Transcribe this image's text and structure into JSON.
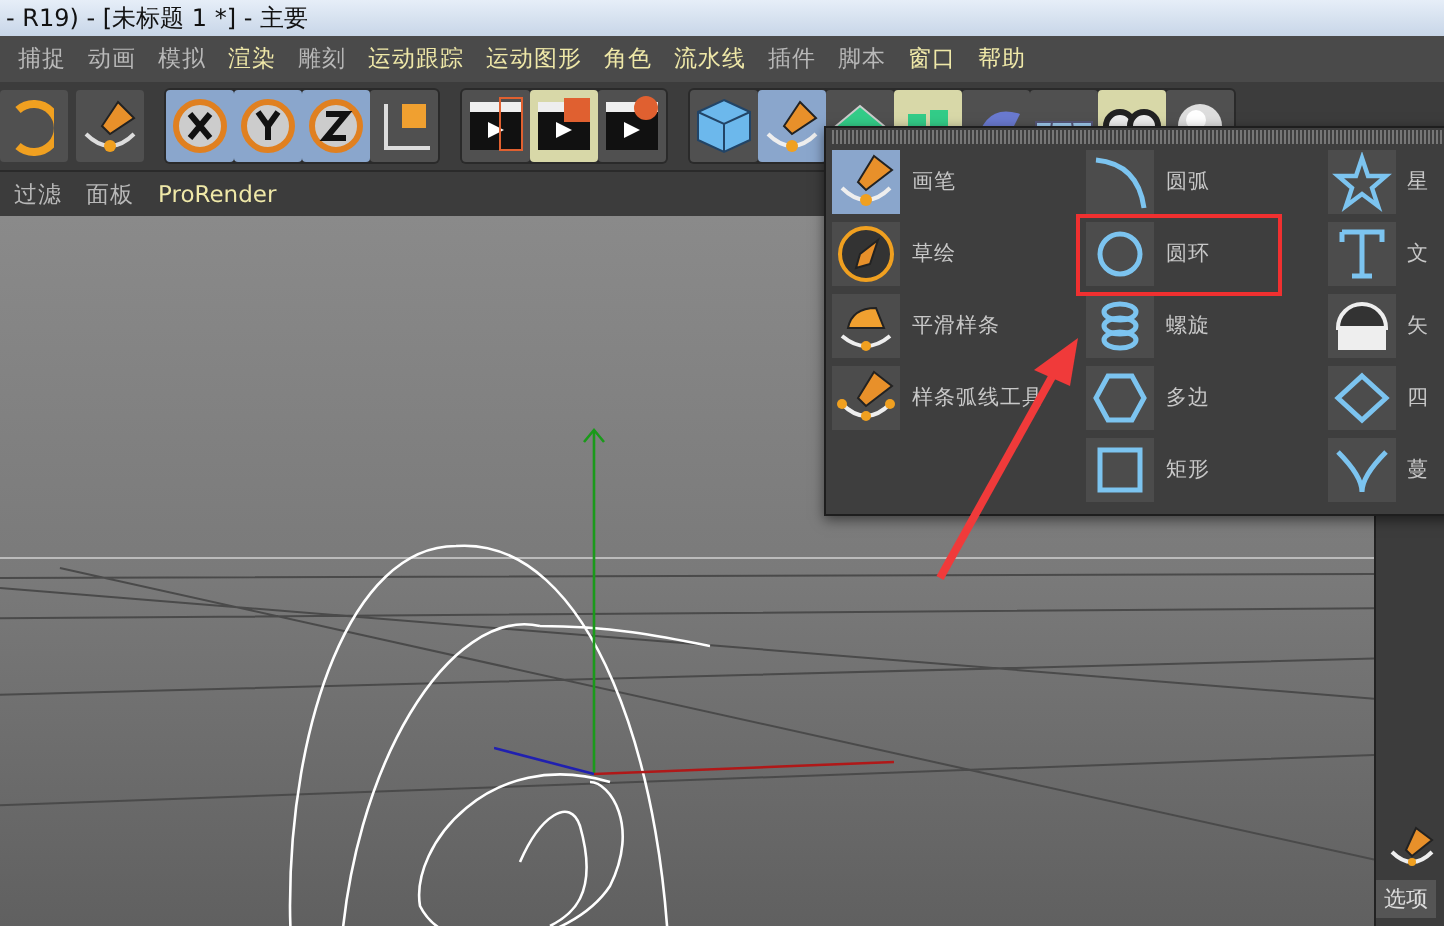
{
  "window": {
    "title": "- R19) - [未标题 1 *] - 主要"
  },
  "menu": [
    {
      "label": "捕捉",
      "highlighted": false
    },
    {
      "label": "动画",
      "highlighted": false
    },
    {
      "label": "模拟",
      "highlighted": false
    },
    {
      "label": "渲染",
      "highlighted": true
    },
    {
      "label": "雕刻",
      "highlighted": false
    },
    {
      "label": "运动跟踪",
      "highlighted": true
    },
    {
      "label": "运动图形",
      "highlighted": true
    },
    {
      "label": "角色",
      "highlighted": true
    },
    {
      "label": "流水线",
      "highlighted": true
    },
    {
      "label": "插件",
      "highlighted": false
    },
    {
      "label": "脚本",
      "highlighted": false
    },
    {
      "label": "窗口",
      "highlighted": true
    },
    {
      "label": "帮助",
      "highlighted": true
    }
  ],
  "viewport_menu": [
    {
      "label": "过滤",
      "highlighted": false
    },
    {
      "label": "面板",
      "highlighted": false
    },
    {
      "label": "ProRender",
      "highlighted": true
    }
  ],
  "spline_menu": {
    "columns": [
      {
        "items": [
          {
            "label": "画笔",
            "kind": "pen",
            "selected": true
          },
          {
            "label": "草绘",
            "kind": "sketch",
            "selected": false
          },
          {
            "label": "平滑样条",
            "kind": "iron",
            "selected": false
          },
          {
            "label": "样条弧线工具",
            "kind": "arcpen",
            "selected": false
          }
        ]
      },
      {
        "items": [
          {
            "label": "圆弧",
            "kind": "arc",
            "selected": false
          },
          {
            "label": "圆环",
            "kind": "circle",
            "selected": false
          },
          {
            "label": "螺旋",
            "kind": "helix",
            "selected": false
          },
          {
            "label": "多边",
            "kind": "hexagon",
            "selected": false
          },
          {
            "label": "矩形",
            "kind": "square",
            "selected": false
          }
        ]
      },
      {
        "items": [
          {
            "label": "星",
            "kind": "star",
            "selected": false
          },
          {
            "label": "文",
            "kind": "text",
            "selected": false
          },
          {
            "label": "矢",
            "kind": "halfcircle",
            "selected": false
          },
          {
            "label": "四",
            "kind": "diamond",
            "selected": false
          },
          {
            "label": "蔓",
            "kind": "vee",
            "selected": false
          }
        ]
      }
    ]
  },
  "side_panel": {
    "tab": "选项"
  }
}
